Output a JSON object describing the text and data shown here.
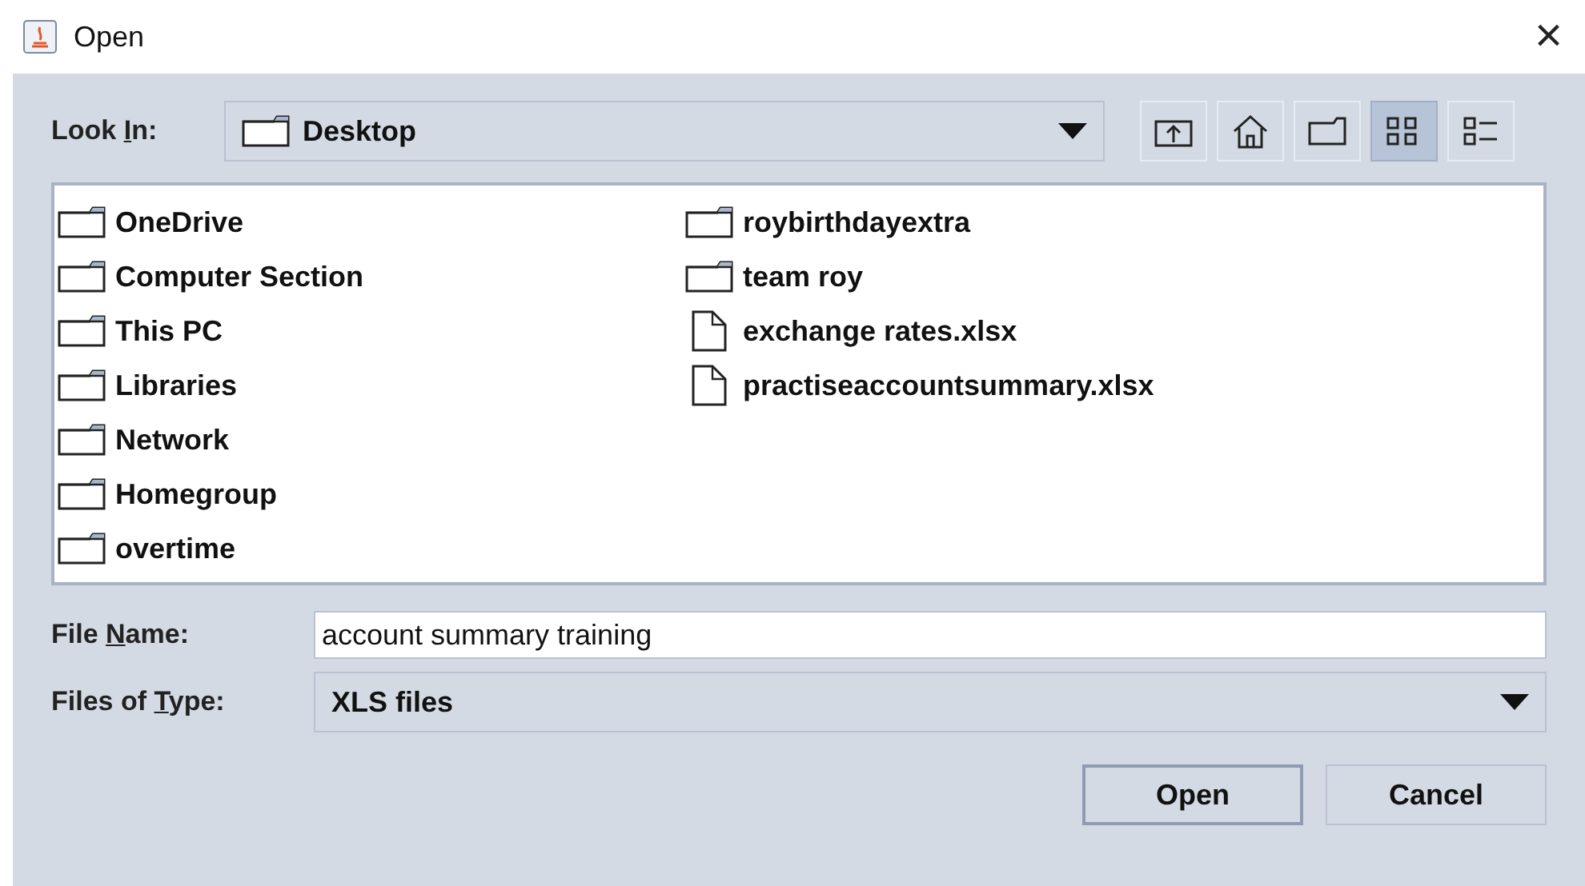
{
  "window": {
    "title": "Open",
    "close": "×"
  },
  "look_in": {
    "label": [
      {
        "text": "Look ",
        "underlined": false
      },
      {
        "text": "I",
        "underlined": true
      },
      {
        "text": "n:",
        "underlined": false
      }
    ],
    "value": "Desktop"
  },
  "toolbar": [
    {
      "kind": "up",
      "selected": false
    },
    {
      "kind": "home",
      "selected": false
    },
    {
      "kind": "new-folder",
      "selected": false
    },
    {
      "kind": "list",
      "selected": true
    },
    {
      "kind": "details",
      "selected": false
    }
  ],
  "files": {
    "columns": [
      [
        {
          "name": "OneDrive",
          "kind": "folder"
        },
        {
          "name": "Computer Section",
          "kind": "folder"
        },
        {
          "name": "This PC",
          "kind": "folder"
        },
        {
          "name": "Libraries",
          "kind": "folder"
        },
        {
          "name": "Network",
          "kind": "folder"
        },
        {
          "name": "Homegroup",
          "kind": "folder"
        },
        {
          "name": "overtime",
          "kind": "folder"
        }
      ],
      [
        {
          "name": "roybirthdayextra",
          "kind": "folder"
        },
        {
          "name": "team roy",
          "kind": "folder"
        },
        {
          "name": "exchange rates.xlsx",
          "kind": "file"
        },
        {
          "name": "practiseaccountsummary.xlsx",
          "kind": "file"
        }
      ]
    ]
  },
  "file_name": {
    "label": [
      {
        "text": "File ",
        "underlined": false
      },
      {
        "text": "N",
        "underlined": true
      },
      {
        "text": "ame:",
        "underlined": false
      }
    ],
    "value": "account summary training"
  },
  "file_type": {
    "label": [
      {
        "text": "Files of ",
        "underlined": false
      },
      {
        "text": "T",
        "underlined": true
      },
      {
        "text": "ype:",
        "underlined": false
      }
    ],
    "value": "XLS files"
  },
  "buttons": [
    {
      "label": "Open",
      "kind": "default"
    },
    {
      "label": "Cancel",
      "kind": "normal"
    }
  ]
}
